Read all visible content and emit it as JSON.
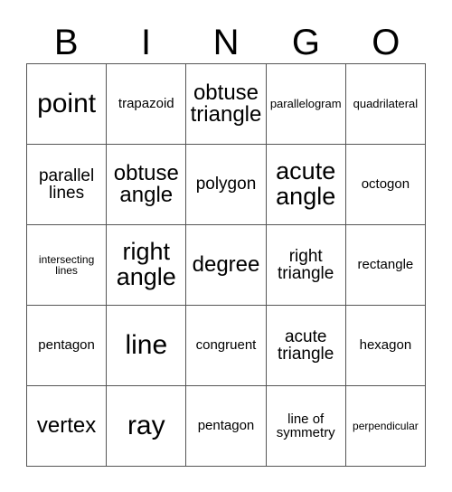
{
  "card": {
    "title": "BINGO",
    "header_letters": [
      "B",
      "I",
      "N",
      "G",
      "O"
    ],
    "colors": {
      "background": "#ffffff",
      "text": "#000000",
      "grid_line": "#555555"
    },
    "rows": [
      [
        {
          "text": "point",
          "size": "fs-xl"
        },
        {
          "text": "trapazoid",
          "size": "fs-xs"
        },
        {
          "text": "obtuse\ntriangle",
          "size": "fs-md"
        },
        {
          "text": "parallelogram",
          "size": "fs-xxs"
        },
        {
          "text": "quadrilateral",
          "size": "fs-xxs"
        }
      ],
      [
        {
          "text": "parallel\nlines",
          "size": "fs-sm"
        },
        {
          "text": "obtuse\nangle",
          "size": "fs-md"
        },
        {
          "text": "polygon",
          "size": "fs-sm"
        },
        {
          "text": "acute\nangle",
          "size": "fs-lg"
        },
        {
          "text": "octogon",
          "size": "fs-xs"
        }
      ],
      [
        {
          "text": "intersecting\nlines",
          "size": "fs-tiny"
        },
        {
          "text": "right\nangle",
          "size": "fs-lg"
        },
        {
          "text": "degree",
          "size": "fs-md"
        },
        {
          "text": "right\ntriangle",
          "size": "fs-sm"
        },
        {
          "text": "rectangle",
          "size": "fs-xs"
        }
      ],
      [
        {
          "text": "pentagon",
          "size": "fs-xs"
        },
        {
          "text": "line",
          "size": "fs-xl"
        },
        {
          "text": "congruent",
          "size": "fs-xs"
        },
        {
          "text": "acute\ntriangle",
          "size": "fs-sm"
        },
        {
          "text": "hexagon",
          "size": "fs-xs"
        }
      ],
      [
        {
          "text": "vertex",
          "size": "fs-md"
        },
        {
          "text": "ray",
          "size": "fs-xl"
        },
        {
          "text": "pentagon",
          "size": "fs-xs"
        },
        {
          "text": "line of\nsymmetry",
          "size": "fs-xs"
        },
        {
          "text": "perpendicular",
          "size": "fs-tiny"
        }
      ]
    ]
  }
}
